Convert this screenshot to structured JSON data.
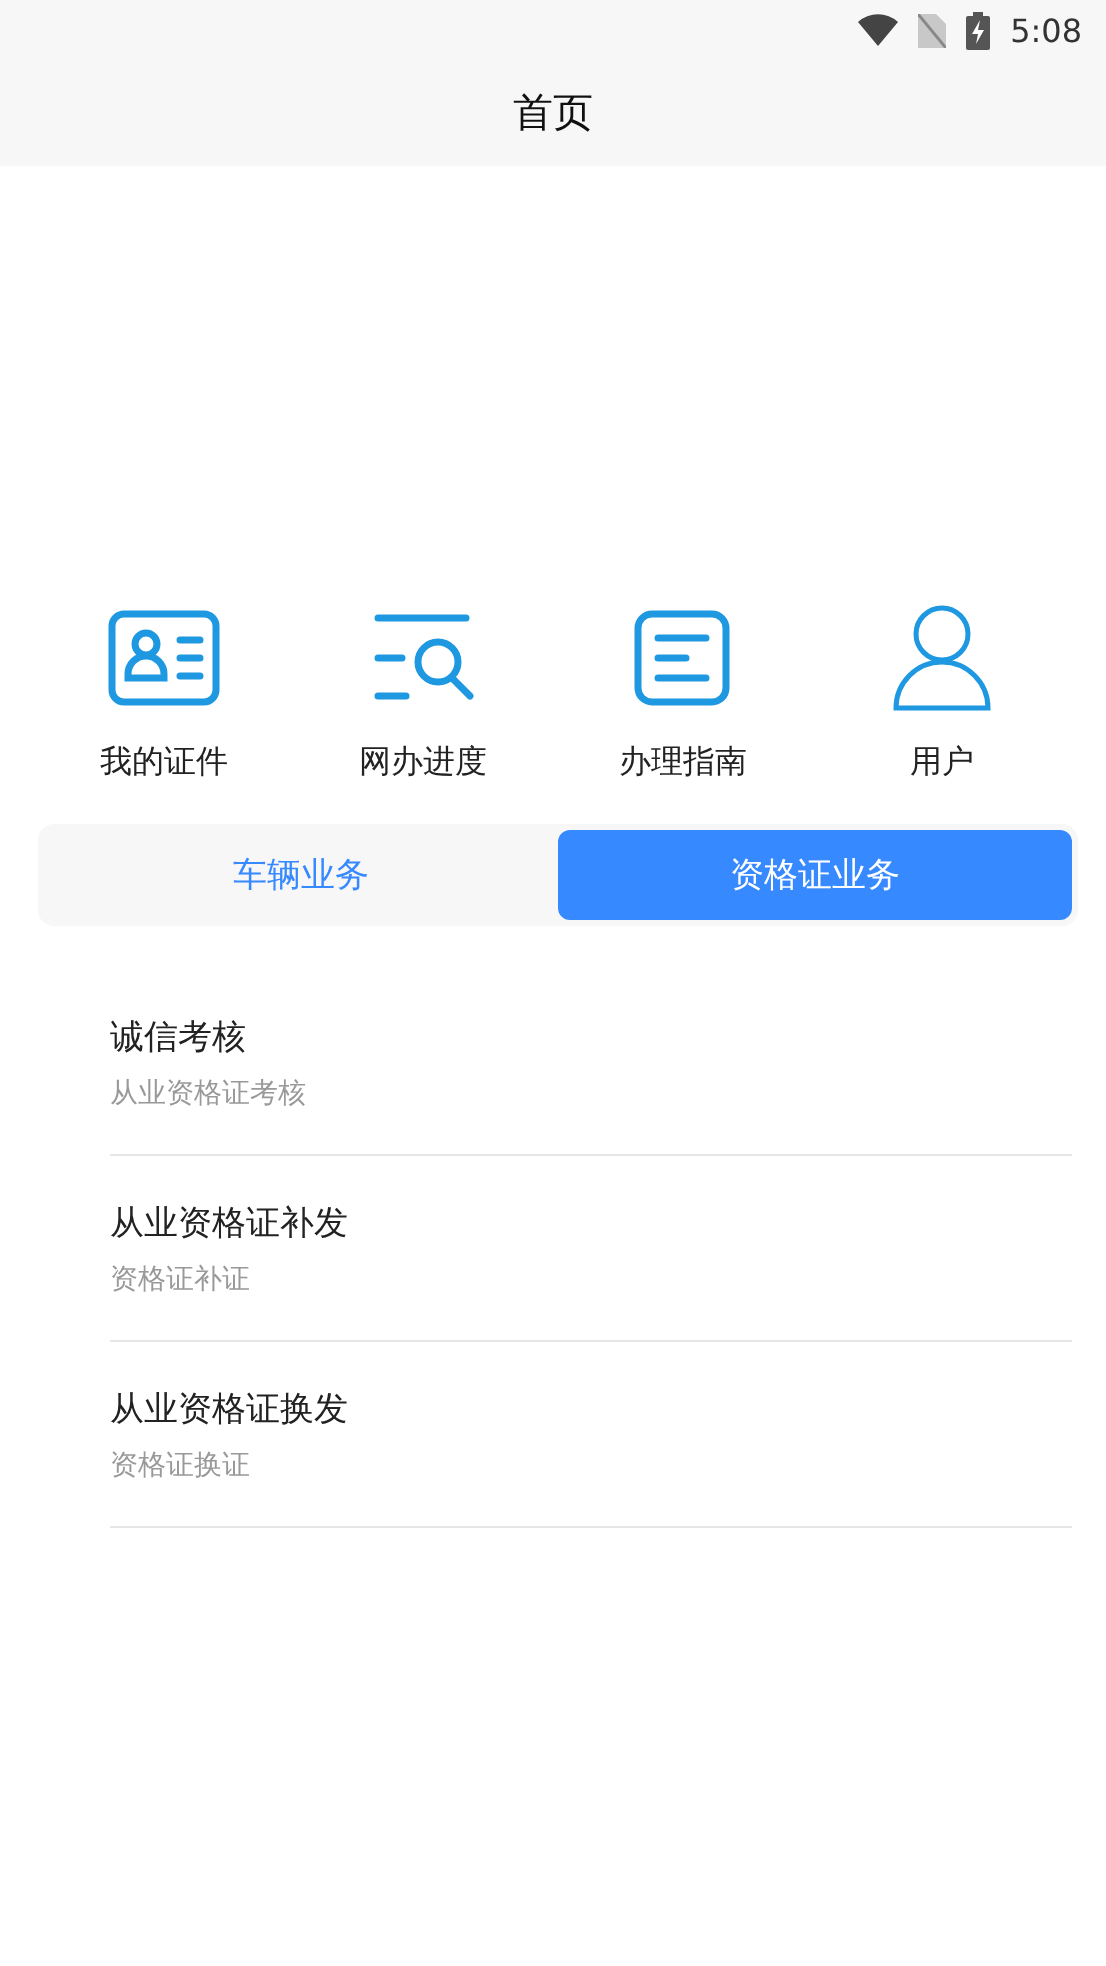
{
  "status_bar": {
    "time": "5:08"
  },
  "header": {
    "title": "首页"
  },
  "shortcuts": [
    {
      "label": "我的证件"
    },
    {
      "label": "网办进度"
    },
    {
      "label": "办理指南"
    },
    {
      "label": "用户"
    }
  ],
  "tabs": [
    {
      "label": "车辆业务",
      "selected": false
    },
    {
      "label": "资格证业务",
      "selected": true
    }
  ],
  "services": [
    {
      "title": "诚信考核",
      "subtitle": "从业资格证考核"
    },
    {
      "title": "从业资格证补发",
      "subtitle": "资格证补证"
    },
    {
      "title": "从业资格证换发",
      "subtitle": "资格证换证"
    }
  ]
}
